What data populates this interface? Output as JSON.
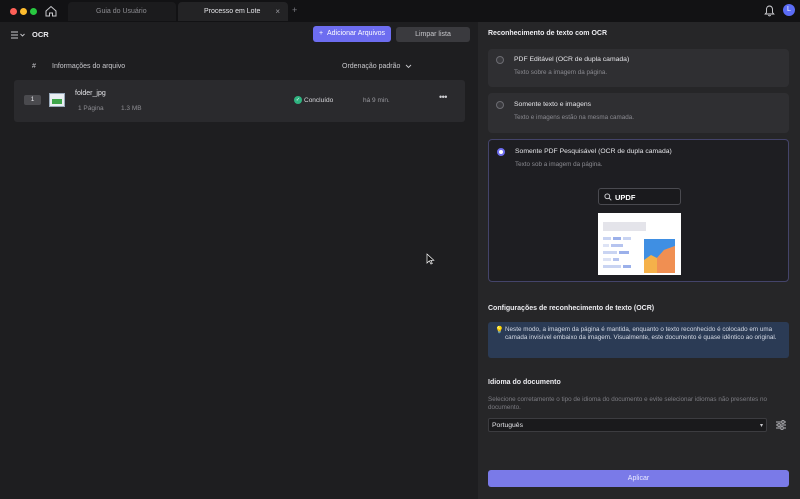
{
  "titlebar": {
    "tabs": [
      {
        "label": "Guia do Usuário",
        "active": false
      },
      {
        "label": "Processo em Lote",
        "active": true
      }
    ],
    "close_glyph": "×",
    "add_glyph": "+",
    "avatar_letter": "L"
  },
  "left": {
    "title": "OCR",
    "add_button": "Adicionar Arquivos",
    "add_glyph": "+",
    "clear_button": "Limpar lista",
    "columns": {
      "number": "#",
      "info": "Informações do arquivo",
      "sort": "Ordenação padrão"
    },
    "files": [
      {
        "index": "1",
        "name": "folder_jpg",
        "pages": "1 Página",
        "size": "1.3 MB",
        "status": "Concluído",
        "time": "há 9 min.",
        "more": "•••"
      }
    ]
  },
  "right": {
    "recognition_title": "Reconhecimento de texto com OCR",
    "options": [
      {
        "title": "PDF Editável (OCR de dupla camada)",
        "desc": "Texto sobre a imagem da página.",
        "selected": false
      },
      {
        "title": "Somente texto e imagens",
        "desc": "Texto e imagens estão na mesma camada.",
        "selected": false
      },
      {
        "title": "Somente PDF Pesquisável (OCR de dupla camada)",
        "desc": "Texto sob a imagem da página.",
        "selected": true
      }
    ],
    "preview_search": "UPDF",
    "settings_title": "Configurações de reconhecimento de texto (OCR)",
    "info_text": "Neste modo, a imagem da página é mantida, enquanto o texto reconhecido é colocado em uma camada invisível embaixo da imagem. Visualmente, este documento é quase idêntico ao original.",
    "language_title": "Idioma do documento",
    "language_desc": "Selecione corretamente o tipo de idioma do documento e evite selecionar idiomas não presentes no documento.",
    "language_value": "Português",
    "apply_button": "Aplicar"
  },
  "colors": {
    "accent": "#6d6df0",
    "success": "#2fb380",
    "info_bg": "#2b3b55"
  }
}
